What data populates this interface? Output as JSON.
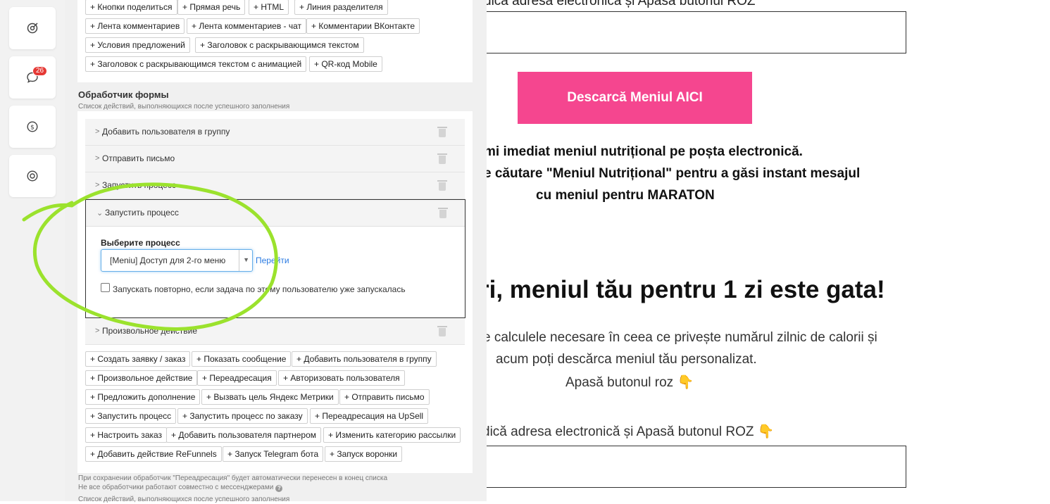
{
  "rail": {
    "items": [
      {
        "icon": "target-icon"
      },
      {
        "icon": "chat-icon",
        "badge": "26"
      },
      {
        "icon": "money-icon"
      },
      {
        "icon": "support-icon"
      }
    ]
  },
  "tags_top": [
    "+ Кнопки поделиться",
    "+ Прямая речь",
    "+ HTML",
    "+ Линия разделителя",
    "+ Лента комментариев",
    "+ Лента комментариев - чат",
    "+ Комментарии ВКонтакте",
    "+ Условия предложений",
    "+ Заголовок с раскрывающимся текстом",
    "+ Заголовок с раскрывающимся текстом с анимацией",
    "+ QR-код Mobile"
  ],
  "form_handler": {
    "title": "Обработчик формы",
    "subtitle": "Список действий, выполняющихся после успешного заполнения",
    "rows": [
      {
        "label": "Добавить пользователя в группу"
      },
      {
        "label": "Отправить письмо"
      },
      {
        "label": "Запустить процесс"
      }
    ],
    "open_row": {
      "label": "Запустить процесс",
      "choose_label": "Выберите процесс",
      "select_value": "[Meniu] Доступ для 2-го меню",
      "goto_link": "Перейти",
      "rerun_label": "Запускать повторно, если задача по этому пользователю уже запускалась",
      "rerun_checked": false
    },
    "last_row": {
      "label": "Произвольное действие"
    },
    "actions": [
      "+ Создать заявку / заказ",
      "+ Показать сообщение",
      "+ Добавить пользователя в группу",
      "+ Произвольное действие",
      "+ Переадресация",
      "+ Авторизовать пользователя",
      "+ Предложить дополнение",
      "+ Вызвать цель Яндекс Метрики",
      "+ Отправить письмо",
      "+ Запустить процесс",
      "+ Запустить процесс по заказу",
      "+ Переадресация на UpSell",
      "+ Настроить заказ",
      "+ Добавить пользователя партнером",
      "+ Изменить категорию рассылки",
      "+ Добавить действие ReFunnels",
      "+ Запуск Telegram бота",
      "+ Запуск воронки"
    ],
    "note1": "При сохранении обработчик \"Переадресация\" будет автоматически перенесен в конец списка",
    "note2": "Не все обработчики работают совместно с мессенджерами",
    "note3": "Список действий, выполняющихся после успешного заполнения"
  },
  "preview": {
    "top_text": "dica adresa electronică și Apasă butonul ROZ",
    "button": "Descarcă Meniul AICI",
    "bold_lines": [
      "mi imediat meniul nutrițional pe poșta electronică.",
      "e căutare \"Meniul Nutrițional\" pentru a găsi instant mesajul",
      "cu meniul pentru MARATON"
    ],
    "heading": "ri, meniul tău pentru 1 zi este gata!",
    "light_lines": [
      "e calculele necesare în ceea ce privește numărul zilnic de calorii și",
      "acum poți descărca meniul tău personalizat.",
      "Apasă butonul roz 👇",
      "dică adresa electronică și Apasă butonul ROZ 👇"
    ]
  },
  "colors": {
    "accent_pink": "#f5468f",
    "marker_green": "#9be22d",
    "link_blue": "#2a7ae2"
  }
}
